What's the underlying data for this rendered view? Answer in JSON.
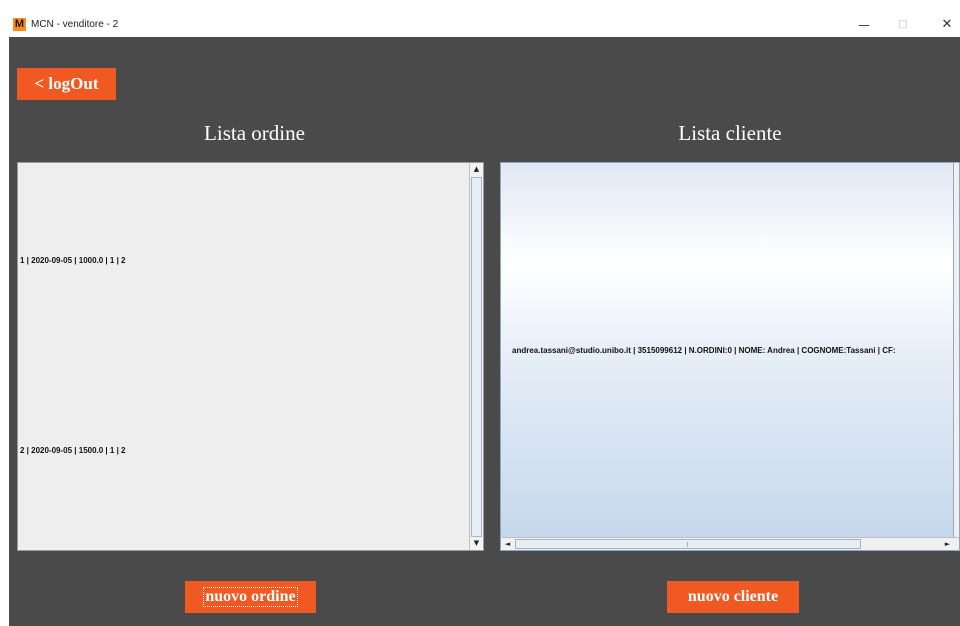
{
  "window": {
    "title": "MCN - venditore - 2",
    "icon_letter": "M",
    "controls": {
      "minimize": "—",
      "maximize": "□",
      "close": "✕"
    }
  },
  "toolbar": {
    "logout_label": "< logOut"
  },
  "orders": {
    "heading": "Lista ordine",
    "items": [
      "1  |  2020-09-05 | 1000.0 | 1 | 2",
      "2  |  2020-09-05 | 1500.0 | 1 | 2"
    ],
    "new_button_label": "nuovo ordine"
  },
  "clients": {
    "heading": "Lista cliente",
    "items": [
      "andrea.tassani@studio.unibo.it | 3515099612 | N.ORDINI:0 | NOME: Andrea | COGNOME:Tassani | CF: "
    ],
    "new_button_label": "nuovo cliente"
  },
  "scroll_arrows": {
    "up": "▲",
    "down": "▼",
    "left": "◄",
    "right": "►"
  },
  "colors": {
    "background": "#4a4a4a",
    "accent": "#f05a22",
    "list_left_bg": "#eeeeee",
    "list_right_gradient": [
      "#dfe8f3",
      "#ffffff",
      "#c3d6eb"
    ]
  }
}
